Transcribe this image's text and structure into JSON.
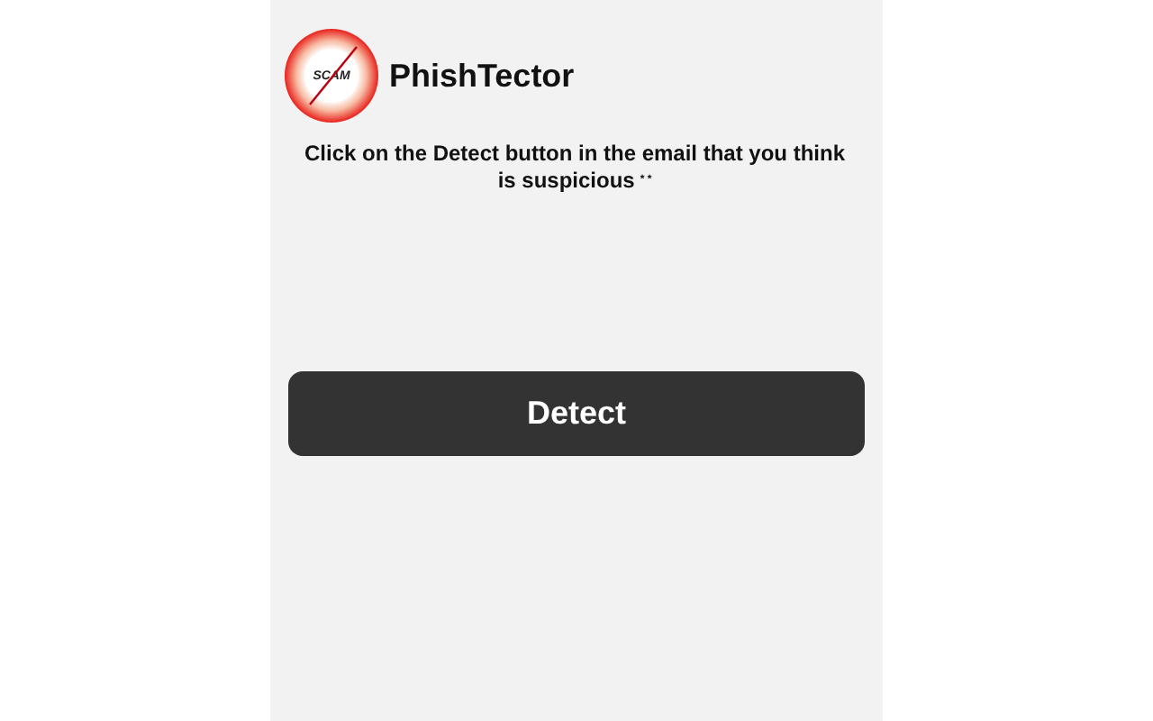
{
  "header": {
    "logo_text": "SCAM",
    "title": "PhishTector"
  },
  "instruction": {
    "text": "Click on the Detect button in the email that you think is suspicious",
    "marks": "* *"
  },
  "button": {
    "label": "Detect"
  }
}
